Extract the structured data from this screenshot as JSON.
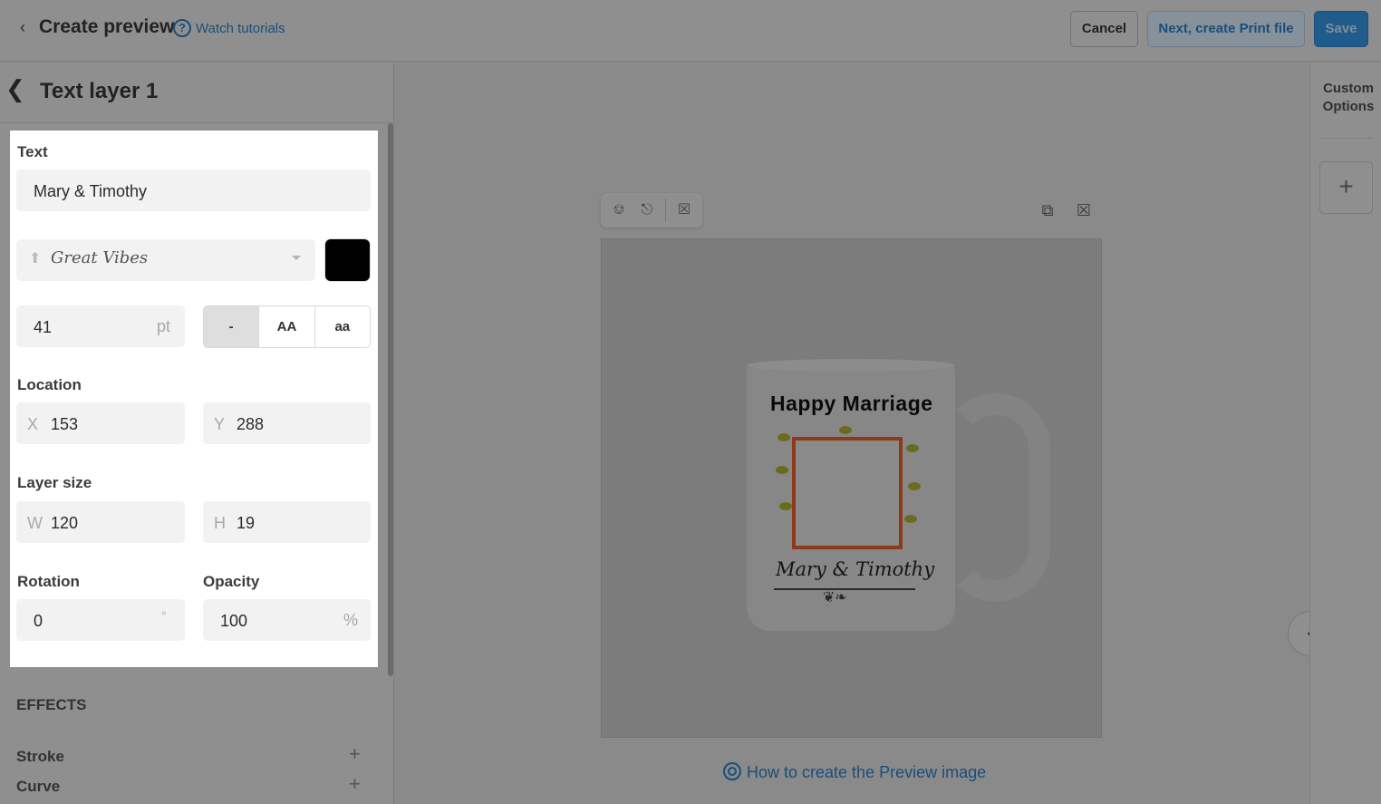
{
  "header": {
    "back_icon": "chevron-left-icon",
    "title": "Create preview",
    "help_icon": "question-circle-icon",
    "help_glyph": "?",
    "tutorials_label": "Watch tutorials",
    "cancel_label": "Cancel",
    "next_label": "Next, create Print file",
    "save_label": "Save"
  },
  "layer_panel": {
    "back_icon": "chevron-left-icon",
    "title": "Text layer 1",
    "text_label": "Text",
    "text_value": "Mary & Timothy",
    "font_name": "Great Vibes",
    "font_color": "#000000",
    "font_size": "41",
    "font_size_unit": "pt",
    "case_options": [
      "-",
      "AA",
      "aa"
    ],
    "case_selected": "-",
    "location_label": "Location",
    "x_prefix": "X",
    "x_value": "153",
    "y_prefix": "Y",
    "y_value": "288",
    "size_label": "Layer size",
    "w_prefix": "W",
    "w_value": "120",
    "h_prefix": "H",
    "h_value": "19",
    "rotation_label": "Rotation",
    "rotation_value": "0",
    "rotation_unit": "°",
    "opacity_label": "Opacity",
    "opacity_value": "100",
    "opacity_unit": "%",
    "effects_label": "EFFECTS",
    "effects": [
      {
        "label": "Stroke"
      },
      {
        "label": "Curve"
      }
    ]
  },
  "canvas": {
    "mug_title": "Happy Marriage",
    "mug_names": "Mary & Timothy",
    "preview_link": "How to create the Preview image"
  },
  "right_rail": {
    "custom_options_label": "Custom Options",
    "add_glyph": "+"
  },
  "colors": {
    "accent": "#1a4e7a",
    "save_button": "#1f5c8c"
  }
}
